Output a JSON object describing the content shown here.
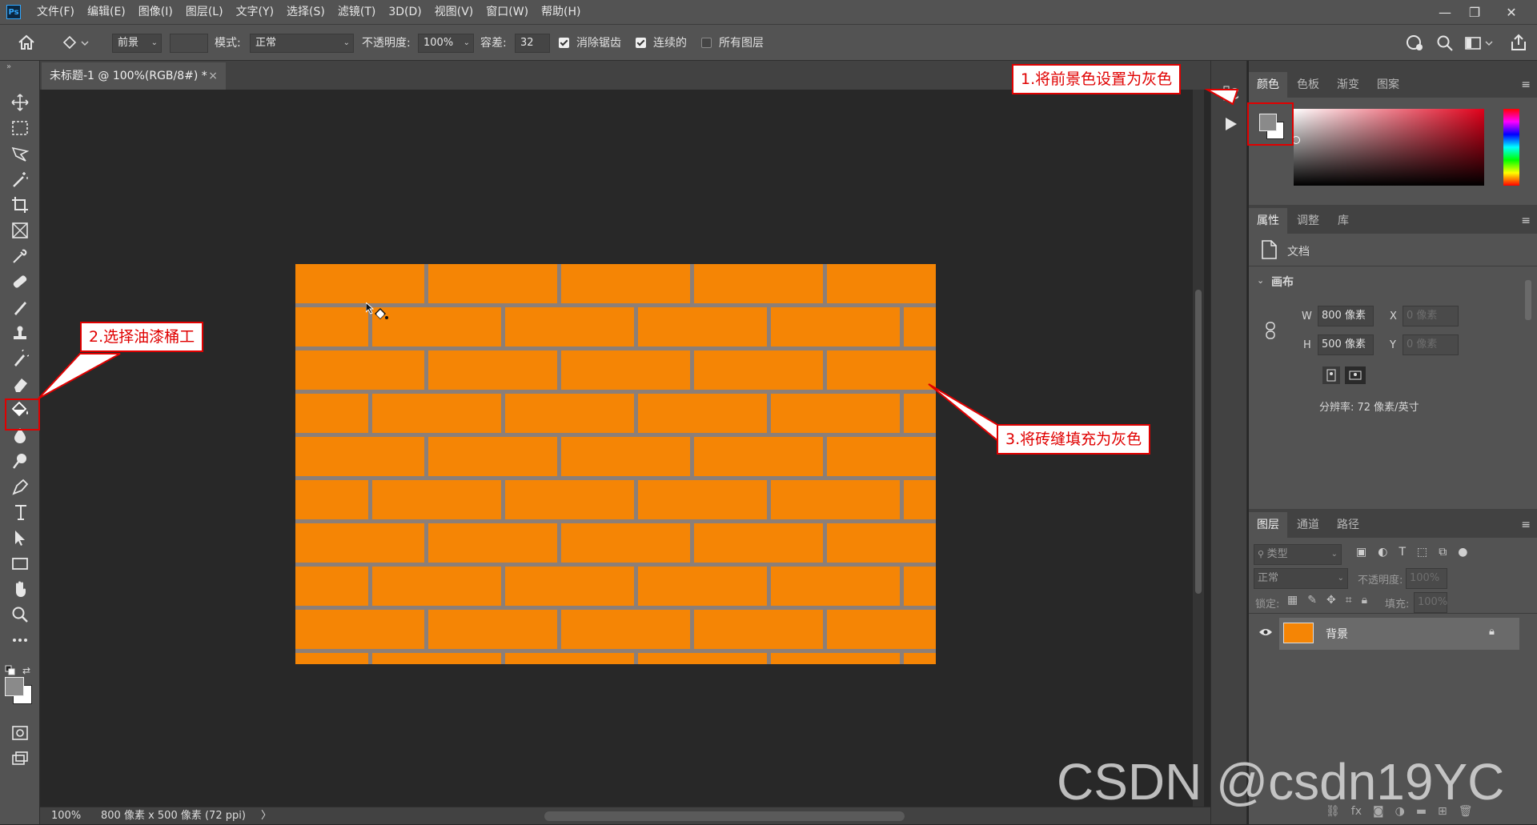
{
  "app": {
    "logo": "Ps"
  },
  "menu": [
    "文件(F)",
    "编辑(E)",
    "图像(I)",
    "图层(L)",
    "文字(Y)",
    "选择(S)",
    "滤镜(T)",
    "3D(D)",
    "视图(V)",
    "窗口(W)",
    "帮助(H)"
  ],
  "window_controls": {
    "minimize": "—",
    "restore": "❐",
    "close": "✕"
  },
  "options": {
    "fill_source": "前景",
    "mode_label": "模式:",
    "mode_value": "正常",
    "opacity_label": "不透明度:",
    "opacity_value": "100%",
    "tolerance_label": "容差:",
    "tolerance_value": "32",
    "antialias_label": "消除锯齿",
    "antialias_checked": true,
    "contiguous_label": "连续的",
    "contiguous_checked": true,
    "all_layers_label": "所有图层",
    "all_layers_checked": false
  },
  "document": {
    "tab_title": "未标题-1 @ 100%(RGB/8#) *",
    "tab_close": "×"
  },
  "canvas": {
    "brick_color": "#f58505",
    "mortar_color": "#8c7f78"
  },
  "tools": [
    "move-icon",
    "marquee-icon",
    "lasso-icon",
    "magic-wand-icon",
    "crop-icon",
    "frame-icon",
    "eyedropper-icon",
    "healing-icon",
    "brush-icon",
    "stamp-icon",
    "history-brush-icon",
    "eraser-icon",
    "paint-bucket-icon",
    "blur-icon",
    "dodge-icon",
    "pen-icon",
    "type-icon",
    "path-select-icon",
    "rectangle-icon",
    "hand-icon",
    "zoom-icon",
    "more-icon"
  ],
  "colors": {
    "foreground": "#8a8a8a",
    "background": "#ffffff"
  },
  "color_panel": {
    "tabs": [
      "颜色",
      "色板",
      "渐变",
      "图案"
    ]
  },
  "properties_panel": {
    "tabs": [
      "属性",
      "调整",
      "库"
    ],
    "doc_label": "文档",
    "section": "画布",
    "w_label": "W",
    "w_value": "800 像素",
    "h_label": "H",
    "h_value": "500 像素",
    "x_label": "X",
    "x_placeholder": "0 像素",
    "y_label": "Y",
    "y_placeholder": "0 像素",
    "resolution": "分辨率: 72 像素/英寸"
  },
  "layers_panel": {
    "tabs": [
      "图层",
      "通道",
      "路径"
    ],
    "filter_placeholder": "类型",
    "blend_mode": "正常",
    "opacity_label": "不透明度:",
    "opacity_value": "100%",
    "lock_label": "锁定:",
    "fill_label": "填充:",
    "fill_value": "100%",
    "layer_name": "背景"
  },
  "status": {
    "zoom": "100%",
    "doc_info": "800 像素 x 500 像素 (72 ppi)",
    "arrow": "〉"
  },
  "annotations": {
    "step1": "1.将前景色设置为灰色",
    "step2": "2.选择油漆桶工",
    "step3": "3.将砖缝填充为灰色"
  },
  "watermark": "CSDN @csdn19YC"
}
